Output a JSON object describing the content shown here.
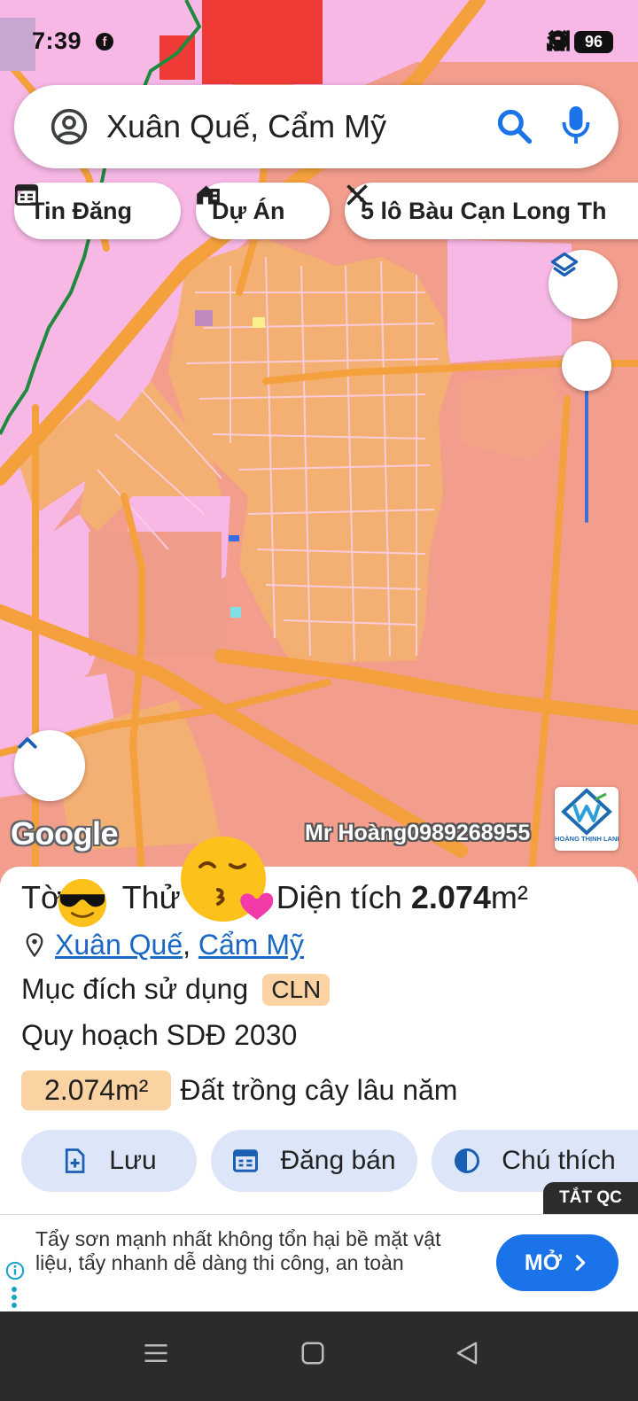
{
  "status_bar": {
    "time": "7:39",
    "volte": "Vo\nLTE",
    "battery": "96"
  },
  "search": {
    "query": "Xuân Quế, Cẩm Mỹ"
  },
  "chips": [
    {
      "label": "Tin Đăng",
      "icon": "listing-icon"
    },
    {
      "label": "Dự Án",
      "icon": "project-icon"
    },
    {
      "label": "5 lô Bàu Cạn Long Th",
      "icon": "measure-icon"
    }
  ],
  "map": {
    "attribution": "Google",
    "watermark": "Mr Hoàng0989268955",
    "brand_logo_text": "HOÀNG THỊNH LAND"
  },
  "parcel": {
    "title_start": "Tờ",
    "title_mid": "Thử",
    "title_area_label": ", Diện tích ",
    "title_area_value": "2.074",
    "title_area_unit": "m²",
    "location_link_1": "Xuân Quế",
    "location_sep": ", ",
    "location_link_2": "Cẩm Mỹ",
    "purpose_label": "Mục đích sử dụng",
    "purpose_code": "CLN",
    "plan_label": "Quy hoạch SDĐ 2030",
    "area_badge": "2.074m²",
    "area_desc": "Đất trồng cây lâu năm"
  },
  "actions": {
    "save": "Lưu",
    "post": "Đăng bán",
    "legend": "Chú thích"
  },
  "ad": {
    "close_label": "TẮT QC",
    "text": "Tẩy sơn mạnh nhất không tổn hại bề mặt vật liệu, tẩy nhanh dễ dàng thi công, an toàn",
    "open_label": "MỞ"
  },
  "colors": {
    "map_residential": "#f7b8e6",
    "map_agricultural": "#f39d8d",
    "map_orange_parcel": "#f4b073",
    "road": "#f4a03c",
    "accent_blue": "#1a73e8",
    "badge_bg": "#fbd3a2"
  }
}
